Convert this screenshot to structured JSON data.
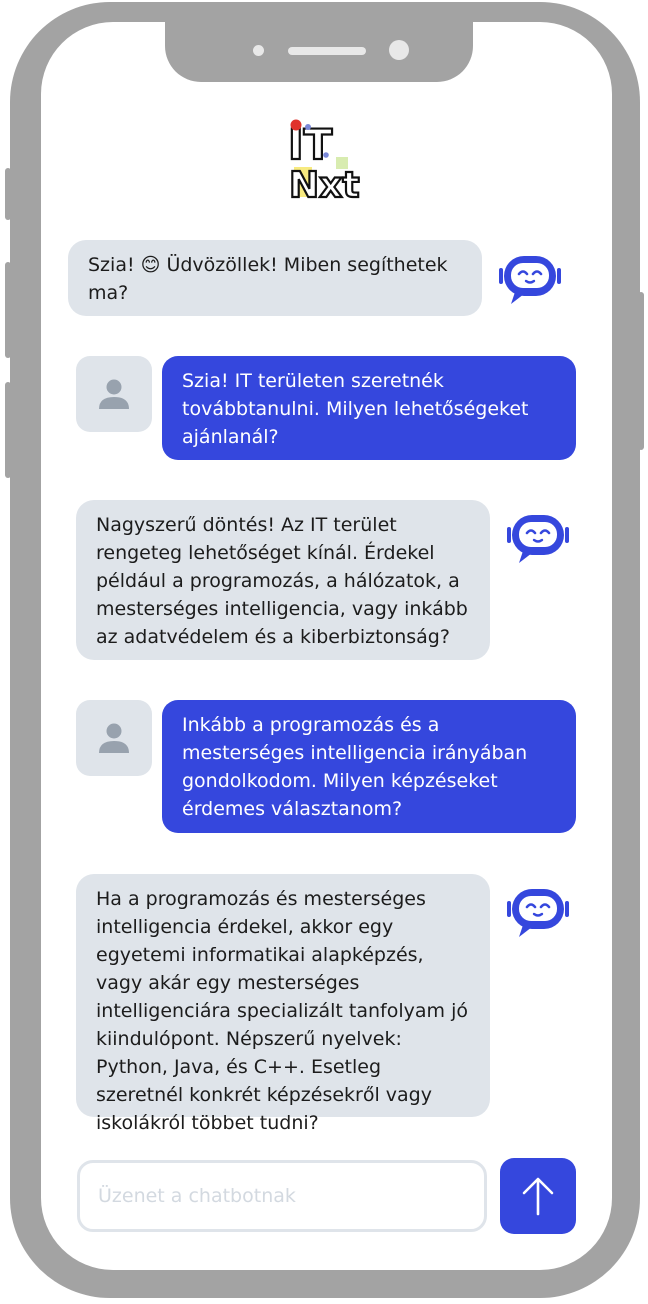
{
  "brand": {
    "logo_line1": "IT",
    "logo_line2": "Nxt"
  },
  "colors": {
    "bot_bubble": "#dfe4ea",
    "user_bubble": "#3547dd",
    "accent": "#3547dd",
    "frame": "#a3a3a3"
  },
  "messages": [
    {
      "sender": "bot",
      "text": "Szia! 😊 Üdvözöllek! Miben segíthetek ma?"
    },
    {
      "sender": "user",
      "text": "Szia! IT területen szeretnék továbbtanulni. Milyen lehetőségeket ajánlanál?"
    },
    {
      "sender": "bot",
      "text": "Nagyszerű döntés! Az IT terület rengeteg lehetőséget kínál. Érdekel például a programozás, a hálózatok, a mesterséges intelligencia, vagy inkább az adatvédelem és a kiberbiztonság?"
    },
    {
      "sender": "user",
      "text": "Inkább a programozás és a mesterséges intelligencia irányában gondolkodom. Milyen képzéseket érdemes választanom?"
    },
    {
      "sender": "bot",
      "text": "Ha a programozás és mesterséges intelligencia érdekel, akkor egy egyetemi informatikai alapképzés, vagy akár egy mesterséges intelligenciára specializált tanfolyam jó kiindulópont. Népszerű nyelvek: Python, Java, és C++. Esetleg szeretnél konkrét képzésekről vagy iskolákról többet tudni?"
    }
  ],
  "composer": {
    "placeholder": "Üzenet a chatbotnak",
    "value": ""
  },
  "icons": {
    "bot": "robot-icon",
    "user": "user-icon",
    "send": "arrow-up-icon"
  }
}
